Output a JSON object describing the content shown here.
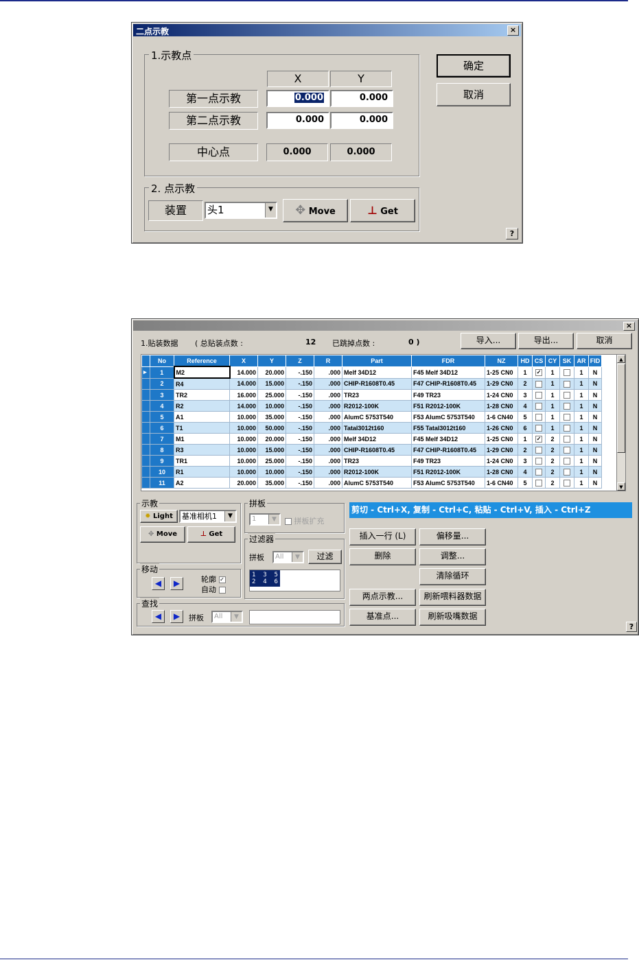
{
  "dialog1": {
    "title": "二点示教",
    "close": "×",
    "group1": "1.示教点",
    "col_x": "X",
    "col_y": "Y",
    "row1_label": "第一点示教",
    "row1_x": "0.000",
    "row1_y": "0.000",
    "row2_label": "第二点示教",
    "row2_x": "0.000",
    "row2_y": "0.000",
    "center_label": "中心点",
    "center_x": "0.000",
    "center_y": "0.000",
    "group2": "2. 点示教",
    "device_label": "装置",
    "device_value": "头1",
    "move": "Move",
    "get": "Get",
    "ok": "确定",
    "cancel": "取消",
    "help": "?"
  },
  "dialog2": {
    "close": "×",
    "summary_label": "1.贴装数据",
    "total_label": "( 总贴装点数 :",
    "total_value": "12",
    "skipped_label": "已跳掉点数 :",
    "skipped_value": "0 )",
    "import": "导入...",
    "export": "导出...",
    "cancel": "取消",
    "columns": [
      "No",
      "Reference",
      "X",
      "Y",
      "Z",
      "R",
      "Part",
      "FDR",
      "NZ",
      "HD",
      "CS",
      "CY",
      "SK",
      "AR",
      "FID"
    ],
    "rows": [
      {
        "no": "1",
        "ref": "M2",
        "x": "14.000",
        "y": "20.000",
        "z": "-.150",
        "r": ".000",
        "part": "Melf 34D12",
        "fdr": "F45 Melf 34D12",
        "nz": "1-25 CN0",
        "hd": "1",
        "cs": "✓",
        "cy": "1",
        "sk": "",
        "ar": "1",
        "fid": "N"
      },
      {
        "no": "2",
        "ref": "R4",
        "x": "14.000",
        "y": "15.000",
        "z": "-.150",
        "r": ".000",
        "part": "CHIP-R1608T0.45",
        "fdr": "F47 CHIP-R1608T0.45",
        "nz": "1-29 CN0",
        "hd": "2",
        "cs": "",
        "cy": "1",
        "sk": "",
        "ar": "1",
        "fid": "N"
      },
      {
        "no": "3",
        "ref": "TR2",
        "x": "16.000",
        "y": "25.000",
        "z": "-.150",
        "r": ".000",
        "part": "TR23",
        "fdr": "F49 TR23",
        "nz": "1-24 CN0",
        "hd": "3",
        "cs": "",
        "cy": "1",
        "sk": "",
        "ar": "1",
        "fid": "N"
      },
      {
        "no": "4",
        "ref": "R2",
        "x": "14.000",
        "y": "10.000",
        "z": "-.150",
        "r": ".000",
        "part": "R2012-100K",
        "fdr": "F51 R2012-100K",
        "nz": "1-28 CN0",
        "hd": "4",
        "cs": "",
        "cy": "1",
        "sk": "",
        "ar": "1",
        "fid": "N"
      },
      {
        "no": "5",
        "ref": "A1",
        "x": "10.000",
        "y": "35.000",
        "z": "-.150",
        "r": ".000",
        "part": "AlumC 5753T540",
        "fdr": "F53 AlumC 5753T540",
        "nz": "1-6 CN40",
        "hd": "5",
        "cs": "",
        "cy": "1",
        "sk": "",
        "ar": "1",
        "fid": "N"
      },
      {
        "no": "6",
        "ref": "T1",
        "x": "10.000",
        "y": "50.000",
        "z": "-.150",
        "r": ".000",
        "part": "Tatal3012t160",
        "fdr": "F55 Tatal3012t160",
        "nz": "1-26 CN0",
        "hd": "6",
        "cs": "",
        "cy": "1",
        "sk": "",
        "ar": "1",
        "fid": "N"
      },
      {
        "no": "7",
        "ref": "M1",
        "x": "10.000",
        "y": "20.000",
        "z": "-.150",
        "r": ".000",
        "part": "Melf 34D12",
        "fdr": "F45 Melf 34D12",
        "nz": "1-25 CN0",
        "hd": "1",
        "cs": "✓",
        "cy": "2",
        "sk": "",
        "ar": "1",
        "fid": "N"
      },
      {
        "no": "8",
        "ref": "R3",
        "x": "10.000",
        "y": "15.000",
        "z": "-.150",
        "r": ".000",
        "part": "CHIP-R1608T0.45",
        "fdr": "F47 CHIP-R1608T0.45",
        "nz": "1-29 CN0",
        "hd": "2",
        "cs": "",
        "cy": "2",
        "sk": "",
        "ar": "1",
        "fid": "N"
      },
      {
        "no": "9",
        "ref": "TR1",
        "x": "10.000",
        "y": "25.000",
        "z": "-.150",
        "r": ".000",
        "part": "TR23",
        "fdr": "F49 TR23",
        "nz": "1-24 CN0",
        "hd": "3",
        "cs": "",
        "cy": "2",
        "sk": "",
        "ar": "1",
        "fid": "N"
      },
      {
        "no": "10",
        "ref": "R1",
        "x": "10.000",
        "y": "10.000",
        "z": "-.150",
        "r": ".000",
        "part": "R2012-100K",
        "fdr": "F51 R2012-100K",
        "nz": "1-28 CN0",
        "hd": "4",
        "cs": "",
        "cy": "2",
        "sk": "",
        "ar": "1",
        "fid": "N"
      },
      {
        "no": "11",
        "ref": "A2",
        "x": "20.000",
        "y": "35.000",
        "z": "-.150",
        "r": ".000",
        "part": "AlumC 5753T540",
        "fdr": "F53 AlumC 5753T540",
        "nz": "1-6 CN40",
        "hd": "5",
        "cs": "",
        "cy": "2",
        "sk": "",
        "ar": "1",
        "fid": "N"
      }
    ],
    "teach_group": "示教",
    "light": "Light",
    "camera": "基准相机1",
    "move": "Move",
    "get": "Get",
    "panel_group": "拼板",
    "panel_value": "1",
    "panel_expand": "拼板扩充",
    "filter_group": "过滤器",
    "filter_panel_label": "拼板",
    "filter_panel_value": "All",
    "filter_button": "过滤",
    "mini_list": "1  3  5\n2  4  6",
    "move_group": "移动",
    "outline": "轮廓",
    "auto": "自动",
    "find_group": "查找",
    "find_panel_label": "拼板",
    "find_panel_value": "All",
    "hint": "剪切 - Ctrl+X, 复制 - Ctrl+C, 粘贴 - Ctrl+V, 插入 - Ctrl+Z",
    "insert_row": "插入一行 (L)",
    "offset": "偏移量...",
    "delete": "删除",
    "adjust": "调整...",
    "clear_loop": "清除循环",
    "two_point": "两点示教...",
    "refresh_feeder": "刷新喂料器数据",
    "base_point": "基准点...",
    "refresh_nozzle": "刷新吸嘴数据",
    "help": "?"
  }
}
